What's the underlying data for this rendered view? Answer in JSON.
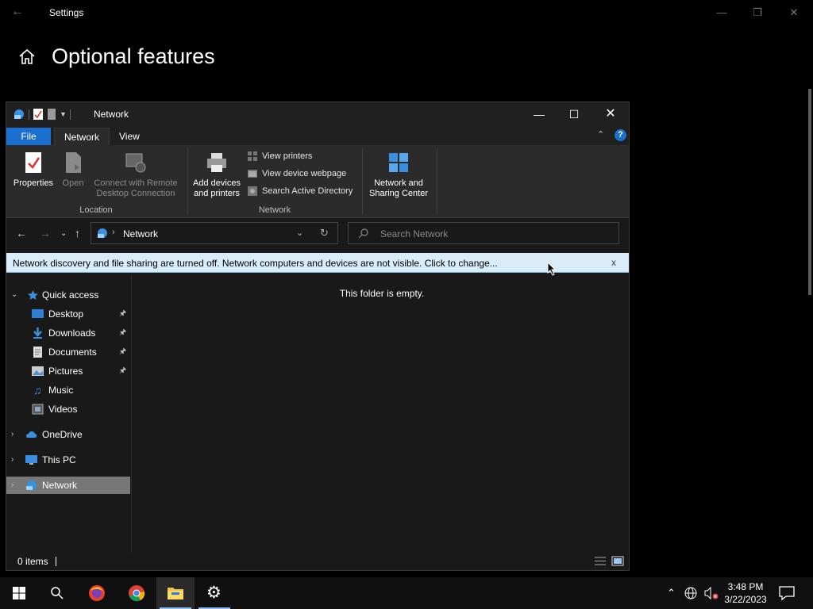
{
  "settings": {
    "title": "Settings",
    "heading": "Optional features"
  },
  "explorer": {
    "title": "Network",
    "tabs": {
      "file": "File",
      "network": "Network",
      "view": "View"
    },
    "help": "?",
    "ribbon": {
      "properties": "Properties",
      "open": "Open",
      "connect_line1": "Connect with Remote",
      "connect_line2": "Desktop Connection",
      "add_devices_line1": "Add devices",
      "add_devices_line2": "and printers",
      "view_printers": "View printers",
      "view_device_webpage": "View device webpage",
      "search_ad": "Search Active Directory",
      "nsc_line1": "Network and",
      "nsc_line2": "Sharing Center",
      "group_location": "Location",
      "group_network": "Network"
    },
    "address": {
      "path": "Network"
    },
    "search": {
      "placeholder": "Search Network"
    },
    "infobar": {
      "text": "Network discovery and file sharing are turned off. Network computers and devices are not visible. Click to change...",
      "close": "x"
    },
    "nav": {
      "quick_access": "Quick access",
      "desktop": "Desktop",
      "downloads": "Downloads",
      "documents": "Documents",
      "pictures": "Pictures",
      "music": "Music",
      "videos": "Videos",
      "onedrive": "OneDrive",
      "this_pc": "This PC",
      "network": "Network"
    },
    "content": {
      "empty": "This folder is empty."
    },
    "status": {
      "items": "0 items"
    }
  },
  "taskbar": {
    "time": "3:48 PM",
    "date": "3/22/2023"
  },
  "colors": {
    "accent": "#1a6fcf",
    "infobar_bg": "#d9ecf9"
  }
}
